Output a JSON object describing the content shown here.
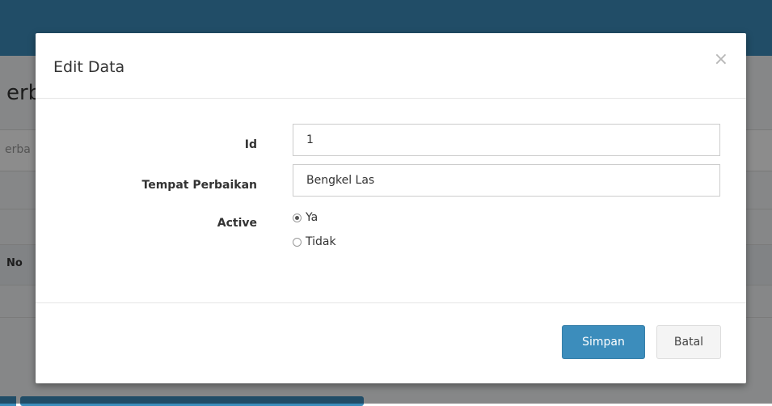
{
  "background": {
    "heading_fragment": "erb",
    "input_fragment": "erba",
    "column_header_fragment": "No"
  },
  "modal": {
    "title": "Edit Data",
    "close_symbol": "×",
    "fields": {
      "id": {
        "label": "Id",
        "value": "1"
      },
      "tempat_perbaikan": {
        "label": "Tempat Perbaikan",
        "value": "Bengkel Las"
      },
      "active": {
        "label": "Active",
        "options": [
          {
            "label": "Ya",
            "checked": true
          },
          {
            "label": "Tidak",
            "checked": false
          }
        ]
      }
    },
    "buttons": {
      "save_label": "Simpan",
      "cancel_label": "Batal"
    }
  },
  "colors": {
    "primary": "#3c8dbc",
    "topbar": "#3c8dbc"
  }
}
